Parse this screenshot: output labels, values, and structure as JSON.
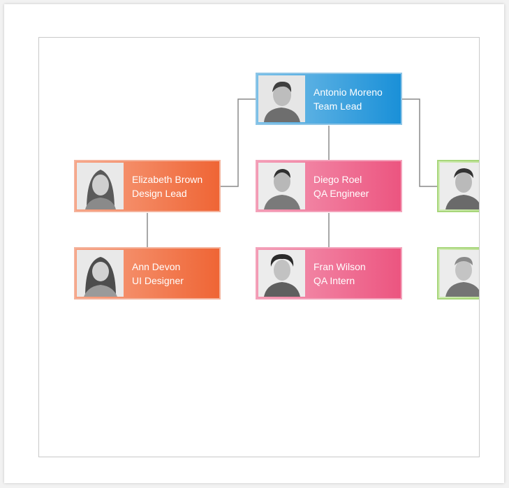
{
  "org_chart": {
    "nodes": [
      {
        "id": "antonio",
        "name": "Antonio Moreno",
        "title": "Team Lead",
        "color": "#1a90d8",
        "photo_icon": "man-portrait-icon"
      },
      {
        "id": "elizabeth",
        "name": "Elizabeth Brown",
        "title": "Design Lead",
        "color": "#ef6535",
        "photo_icon": "woman-portrait-icon"
      },
      {
        "id": "diego",
        "name": "Diego Roel",
        "title": "QA Engineer",
        "color": "#ec5580",
        "photo_icon": "man-portrait-icon"
      },
      {
        "id": "ann",
        "name": "Ann Devon",
        "title": "UI Designer",
        "color": "#ef6535",
        "photo_icon": "woman-portrait-icon"
      },
      {
        "id": "fran",
        "name": "Fran Wilson",
        "title": "QA Intern",
        "color": "#ec5580",
        "photo_icon": "man-portrait-icon"
      },
      {
        "id": "right-top",
        "name": "",
        "title": "",
        "color": "#8bc34a",
        "photo_icon": "man-portrait-icon"
      },
      {
        "id": "right-bottom",
        "name": "",
        "title": "",
        "color": "#8bc34a",
        "photo_icon": "man-portrait-icon"
      }
    ],
    "edges": [
      [
        "antonio",
        "elizabeth"
      ],
      [
        "antonio",
        "diego"
      ],
      [
        "antonio",
        "right-top"
      ],
      [
        "elizabeth",
        "ann"
      ],
      [
        "diego",
        "fran"
      ],
      [
        "right-top",
        "right-bottom"
      ]
    ],
    "connector_color": "#8a8a8a"
  }
}
